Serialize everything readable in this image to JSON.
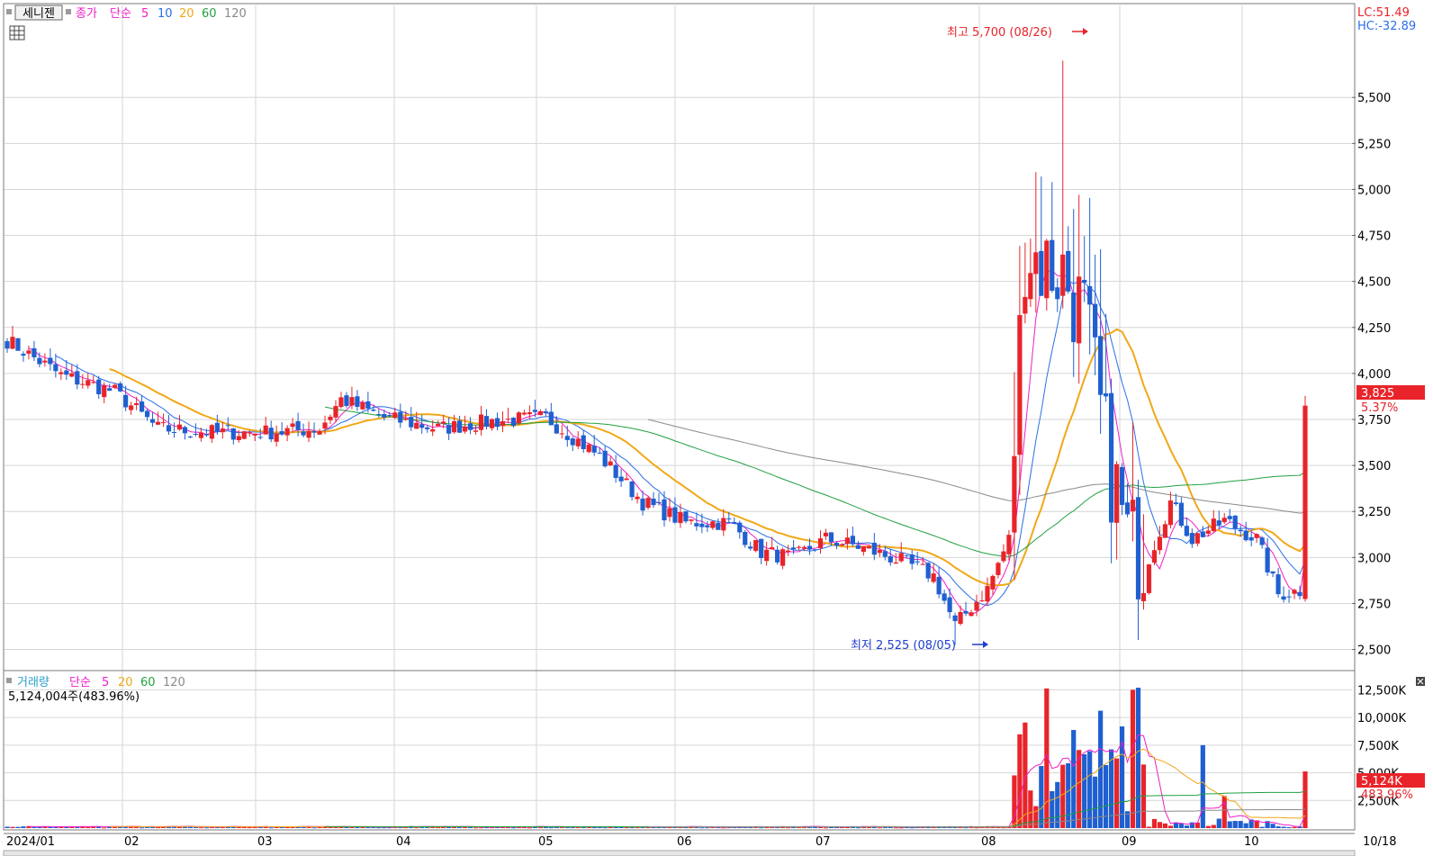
{
  "header": {
    "stock_name": "세니젠",
    "price_type": "종가",
    "ma_type": "단순",
    "ma_periods": [
      "5",
      "10",
      "20",
      "60",
      "120"
    ],
    "lc": "LC:51.49",
    "hc": "HC:-32.89"
  },
  "volume_header": {
    "title": "거래량",
    "ma_type": "단순",
    "ma_periods": [
      "5",
      "20",
      "60",
      "120"
    ],
    "current_volume": "5,124,004주(483.96%)"
  },
  "annotations": {
    "high": "최고 5,700 (08/26)",
    "low": "최저 2,525 (08/05)"
  },
  "price_tag": {
    "value": "3,825",
    "change": "5.37%"
  },
  "volume_tag": {
    "value": "5,124K",
    "change": "483.96%"
  },
  "colors": {
    "up": "#e8242a",
    "down": "#1f5fd0",
    "ma5": "#f01ec8",
    "ma10": "#2a6ee8",
    "ma20": "#f0a818",
    "ma60": "#20a040",
    "ma120": "#8a8a8a"
  },
  "chart_data": [
    {
      "type": "candlestick",
      "title": "세니젠",
      "x_labels": [
        "2024/01",
        "02",
        "03",
        "04",
        "05",
        "06",
        "07",
        "08",
        "09",
        "10",
        "10/18"
      ],
      "y_ticks": [
        "5,500",
        "5,250",
        "5,000",
        "4,750",
        "4,500",
        "4,250",
        "4,000",
        "3,750",
        "3,500",
        "3,250",
        "3,000",
        "2,750",
        "2,500"
      ],
      "ylim": [
        2400,
        6000
      ],
      "high": {
        "value": 5700,
        "date": "08/26"
      },
      "low": {
        "value": 2525,
        "date": "08/05"
      },
      "last_close": 3825,
      "change_pct": 5.37,
      "grid": true
    },
    {
      "type": "bar",
      "title": "거래량",
      "y_ticks": [
        "12,500K",
        "10,000K",
        "7,500K",
        "5,000K",
        "2,500K"
      ],
      "ylim": [
        0,
        14000
      ],
      "last_volume_k": 5124,
      "last_volume_ratio_pct": 483.96,
      "grid": true
    }
  ]
}
